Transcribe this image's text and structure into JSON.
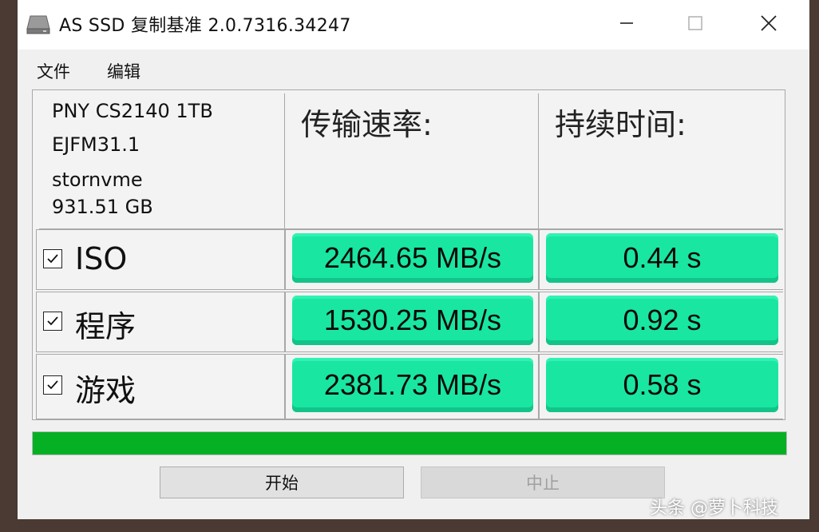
{
  "window": {
    "title": "AS SSD 复制基准 2.0.7316.34247",
    "controls": {
      "minimize": "minimize-icon",
      "maximize": "maximize-icon",
      "close": "close-icon"
    }
  },
  "menu": {
    "items": [
      "文件",
      "编辑"
    ]
  },
  "drive": {
    "model": "PNY CS2140 1TB",
    "firmware": "EJFM31.1",
    "driver": "stornvme",
    "capacity": "931.51 GB"
  },
  "headers": {
    "speed": "传输速率:",
    "time": "持续时间:"
  },
  "rows": [
    {
      "label": "ISO",
      "checked": true,
      "speed": "2464.65 MB/s",
      "time": "0.44 s"
    },
    {
      "label": "程序",
      "checked": true,
      "speed": "1530.25 MB/s",
      "time": "0.92 s"
    },
    {
      "label": "游戏",
      "checked": true,
      "speed": "2381.73 MB/s",
      "time": "0.58 s"
    }
  ],
  "progress": {
    "value": 1.0,
    "color": "#06b025"
  },
  "buttons": {
    "start": "开始",
    "stop": "中止"
  },
  "colors": {
    "result_green": "#19e6a1"
  },
  "watermark": "头条 @萝卜科技"
}
